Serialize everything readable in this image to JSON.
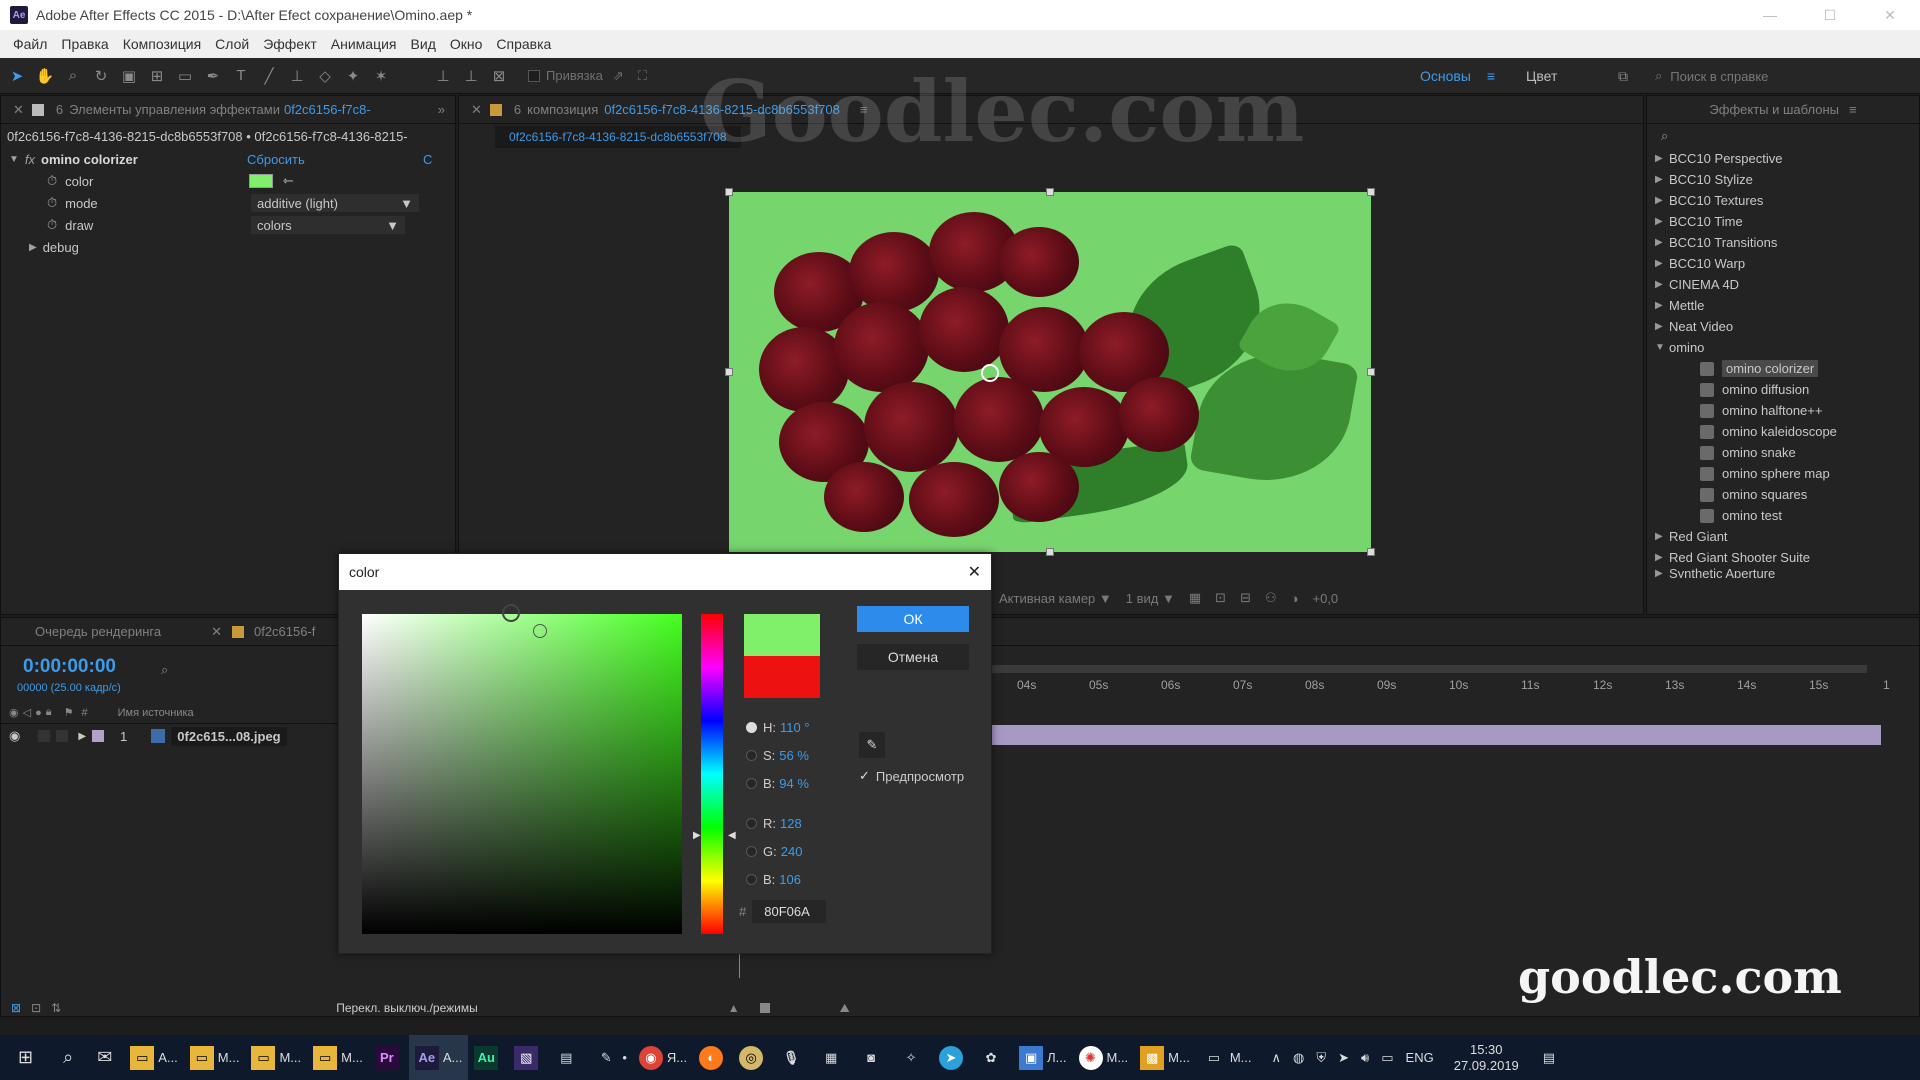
{
  "window": {
    "title": "Adobe After Effects CC 2015 - D:\\After Efect сохранение\\Omino.aep *",
    "app_icon": "Ae",
    "min": "—",
    "max": "☐",
    "close": "✕"
  },
  "menu": [
    "Файл",
    "Правка",
    "Композиция",
    "Слой",
    "Эффект",
    "Анимация",
    "Вид",
    "Окно",
    "Справка"
  ],
  "toolbar": {
    "snap_label": "Привязка",
    "workspace_main": "Основы",
    "workspace_color": "Цвет",
    "search_placeholder": "Поиск в справке"
  },
  "effect_controls": {
    "tab_label": "Элементы управления эффектами",
    "tab_layer": "0f2c6156-f7c8-",
    "breadcrumb": "0f2c6156-f7c8-4136-8215-dc8b6553f708 • 0f2c6156-f7c8-4136-8215-",
    "effect_name": "omino colorizer",
    "reset": "Сбросить",
    "about": "С",
    "params": [
      {
        "name": "color"
      },
      {
        "name": "mode",
        "value": "additive (light)"
      },
      {
        "name": "draw",
        "value": "colors"
      }
    ],
    "group": "debug",
    "color_value": "#80F06A"
  },
  "composition": {
    "tab_label": "композиция",
    "tab_name": "0f2c6156-f7c8-4136-8215-dc8b6553f708",
    "subtab": "0f2c6156-f7c8-4136-8215-dc8b6553f708",
    "camera": "Активная камер",
    "views": "1 вид",
    "exposure": "+0,0"
  },
  "effects_presets": {
    "title": "Эффекты и шаблоны",
    "items": [
      "BCC10 Perspective",
      "BCC10 Stylize",
      "BCC10 Textures",
      "BCC10 Time",
      "BCC10 Transitions",
      "BCC10 Warp",
      "CINEMA 4D",
      "Mettle",
      "Neat Video"
    ],
    "expanded": "omino",
    "sub_items": [
      "omino colorizer",
      "omino diffusion",
      "omino halftone++",
      "omino kaleidoscope",
      "omino snake",
      "omino sphere map",
      "omino squares",
      "omino test"
    ],
    "after": [
      "Red Giant",
      "Red Giant Shooter Suite",
      "Synthetic Aperture"
    ]
  },
  "timeline": {
    "render_queue": "Очередь рендеринга",
    "comp_tab": "0f2c6156-f",
    "timecode": "0:00:00:00",
    "frame_info": "00000 (25.00 кадр/с)",
    "source_name_header": "Имя источника",
    "layer_index": "1",
    "layer_name": "0f2c615...08.jpeg",
    "ruler": [
      "04s",
      "05s",
      "06s",
      "07s",
      "08s",
      "09s",
      "10s",
      "11s",
      "12s",
      "13s",
      "14s",
      "15s",
      "1"
    ],
    "toggle_label": "Перекл. выключ./режимы"
  },
  "color_dialog": {
    "title": "color",
    "ok": "ОК",
    "cancel": "Отмена",
    "preview_label": "Предпросмотр",
    "new_color": "#80F06A",
    "old_color": "#EE1111",
    "fields": [
      {
        "label": "H:",
        "value": "110 °"
      },
      {
        "label": "S:",
        "value": "56 %"
      },
      {
        "label": "B:",
        "value": "94 %"
      },
      {
        "label": "R:",
        "value": "128"
      },
      {
        "label": "G:",
        "value": "240"
      },
      {
        "label": "B:",
        "value": "106"
      }
    ],
    "hex_label": "#",
    "hex": "80F06A"
  },
  "watermarks": {
    "top": "Goodlec.com",
    "bottom": "goodlec.com"
  },
  "taskbar": {
    "items": [
      {
        "label": "A...",
        "icon": "folder-icon"
      },
      {
        "label": "M...",
        "icon": "folder-icon"
      },
      {
        "label": "M...",
        "icon": "folder-icon"
      },
      {
        "label": "M...",
        "icon": "folder-icon"
      },
      {
        "label": "",
        "icon": "Pr"
      },
      {
        "label": "A...",
        "icon": "Ae"
      },
      {
        "label": "",
        "icon": "Au"
      },
      {
        "label": "Я...",
        "icon": "chrome-icon"
      },
      {
        "label": "Л...",
        "icon": "app-icon"
      },
      {
        "label": "M...",
        "icon": "app-icon"
      },
      {
        "label": "M...",
        "icon": "app-icon"
      },
      {
        "label": "M...",
        "icon": "app-icon"
      }
    ],
    "lang": "ENG",
    "time": "15:30",
    "date": "27.09.2019"
  }
}
